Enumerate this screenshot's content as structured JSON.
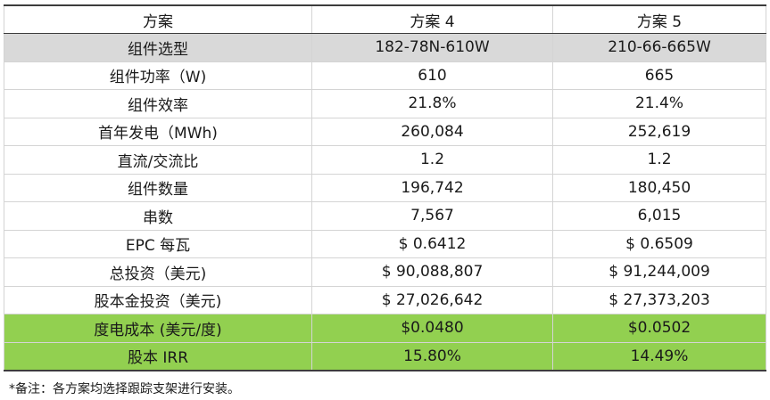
{
  "table": {
    "headers": [
      "方案",
      "方案 4",
      "方案 5"
    ],
    "rows": [
      [
        "组件选型",
        "182-78N-610W",
        "210-66-665W"
      ],
      [
        "组件功率（W)",
        "610",
        "665"
      ],
      [
        "组件效率",
        "21.8%",
        "21.4%"
      ],
      [
        "首年发电（MWh)",
        "260,084",
        "252,619"
      ],
      [
        "直流/交流比",
        "1.2",
        "1.2"
      ],
      [
        "组件数量",
        "196,742",
        "180,450"
      ],
      [
        "串数",
        "7,567",
        "6,015"
      ],
      [
        "EPC 每瓦",
        "$ 0.6412",
        "$ 0.6509"
      ],
      [
        "总投资（美元)",
        "$ 90,088,807",
        "$ 91,244,009"
      ],
      [
        "股本金投资（美元)",
        "$ 27,026,642",
        "$ 27,373,203"
      ],
      [
        "度电成本 (美元/度)",
        "$0.0480",
        "$0.0502"
      ],
      [
        "股本 IRR",
        "15.80%",
        "14.49%"
      ]
    ]
  },
  "note": "*备注：各方案均选择跟踪支架进行安装。",
  "colors": {
    "header_shade": "#d9d9d9",
    "highlight_green": "#92d050"
  }
}
